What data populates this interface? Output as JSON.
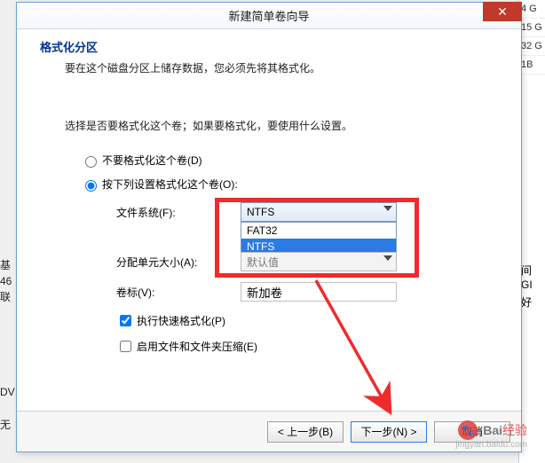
{
  "bg": {
    "right_rows": [
      "4 G",
      "15 G",
      "32 G",
      "1B"
    ],
    "left_col": "基\n46\n联",
    "dv": "DV",
    "wu": "无",
    "jian": "间",
    "gi": "GI",
    "hao": "好"
  },
  "dialog": {
    "title": "新建简单卷向导",
    "heading": "格式化分区",
    "subheading": "要在这个磁盘分区上储存数据，您必须先将其格式化。",
    "prompt": "选择是否要格式化这个卷；如果要格式化，要使用什么设置。",
    "radio_noformat": "不要格式化这个卷(D)",
    "radio_format": "按下列设置格式化这个卷(O):",
    "fields": {
      "filesystem_label": "文件系统(F):",
      "filesystem_value": "NTFS",
      "filesystem_options": [
        "FAT32",
        "NTFS"
      ],
      "alloc_label": "分配单元大小(A):",
      "alloc_value": "默认值",
      "volume_label_label": "卷标(V):",
      "volume_label_value": "新加卷"
    },
    "checks": {
      "quick_format": "执行快速格式化(P)",
      "compress": "启用文件和文件夹压缩(E)"
    },
    "buttons": {
      "back": "< 上一步(B)",
      "next": "下一步(N) >",
      "cancel": "取消"
    }
  },
  "watermark": {
    "brand": "Bai",
    "brand2": "经验",
    "sub": "jingyan.baidu.com"
  }
}
